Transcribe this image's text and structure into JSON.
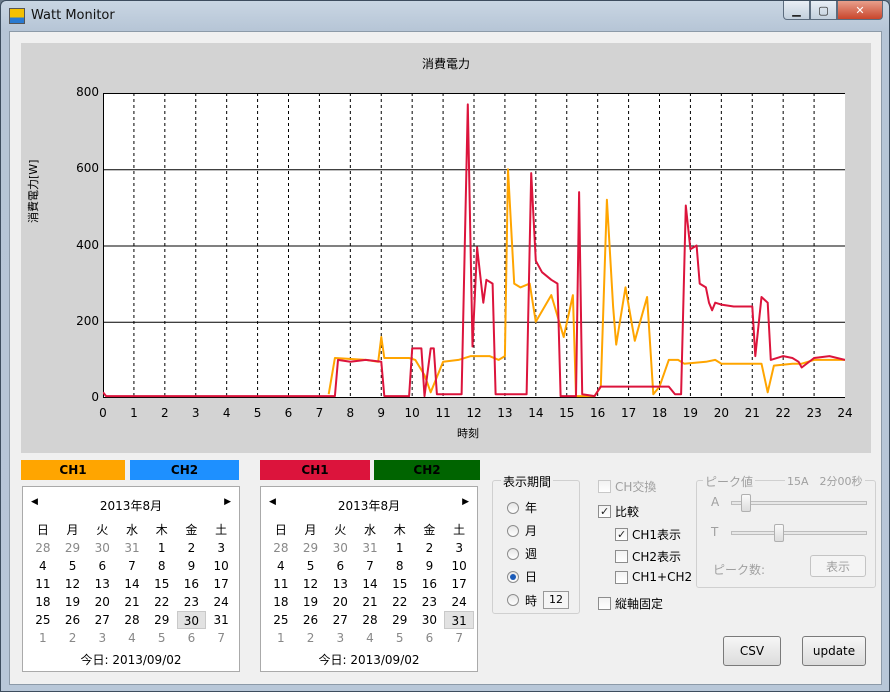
{
  "window": {
    "title": "Watt Monitor"
  },
  "chart_data": {
    "type": "line",
    "title": "消費電力",
    "xlabel": "時刻",
    "ylabel": "消費電力[W]",
    "xlim": [
      0,
      24
    ],
    "ylim": [
      0,
      800
    ],
    "x_ticks": [
      "0",
      "1",
      "2",
      "3",
      "4",
      "5",
      "6",
      "7",
      "8",
      "9",
      "10",
      "11",
      "12",
      "13",
      "14",
      "15",
      "16",
      "17",
      "18",
      "19",
      "20",
      "21",
      "22",
      "23",
      "24"
    ],
    "y_ticks": [
      "0",
      "200",
      "400",
      "600",
      "800"
    ],
    "series": [
      {
        "color": "#dc143c",
        "points": [
          [
            0,
            15
          ],
          [
            0.1,
            5
          ],
          [
            7.5,
            5
          ],
          [
            7.6,
            100
          ],
          [
            8,
            95
          ],
          [
            8.5,
            100
          ],
          [
            9,
            95
          ],
          [
            9.1,
            5
          ],
          [
            9.9,
            5
          ],
          [
            10,
            130
          ],
          [
            10.3,
            130
          ],
          [
            10.4,
            5
          ],
          [
            10.6,
            130
          ],
          [
            10.7,
            130
          ],
          [
            10.8,
            10
          ],
          [
            11.6,
            10
          ],
          [
            11.8,
            770
          ],
          [
            11.95,
            135
          ],
          [
            12.1,
            395
          ],
          [
            12.3,
            250
          ],
          [
            12.4,
            310
          ],
          [
            12.6,
            300
          ],
          [
            12.7,
            10
          ],
          [
            13.7,
            10
          ],
          [
            13.85,
            590
          ],
          [
            14,
            360
          ],
          [
            14.2,
            330
          ],
          [
            14.5,
            310
          ],
          [
            14.7,
            300
          ],
          [
            14.8,
            5
          ],
          [
            15.3,
            5
          ],
          [
            15.4,
            540
          ],
          [
            15.5,
            10
          ],
          [
            15.9,
            5
          ],
          [
            16.1,
            30
          ],
          [
            17.5,
            30
          ],
          [
            18.3,
            30
          ],
          [
            18.5,
            10
          ],
          [
            18.7,
            10
          ],
          [
            18.85,
            505
          ],
          [
            19,
            390
          ],
          [
            19.2,
            400
          ],
          [
            19.3,
            300
          ],
          [
            19.5,
            290
          ],
          [
            19.6,
            250
          ],
          [
            19.7,
            230
          ],
          [
            19.8,
            250
          ],
          [
            20,
            245
          ],
          [
            20.4,
            240
          ],
          [
            21,
            240
          ],
          [
            21.1,
            110
          ],
          [
            21.3,
            265
          ],
          [
            21.5,
            250
          ],
          [
            21.6,
            100
          ],
          [
            22,
            110
          ],
          [
            22.3,
            105
          ],
          [
            22.5,
            95
          ],
          [
            22.6,
            80
          ],
          [
            23,
            105
          ],
          [
            23.5,
            110
          ],
          [
            24,
            100
          ]
        ]
      },
      {
        "color": "#ffa500",
        "points": [
          [
            7.3,
            10
          ],
          [
            7.5,
            105
          ],
          [
            8.5,
            100
          ],
          [
            8.9,
            95
          ],
          [
            9,
            160
          ],
          [
            9.1,
            105
          ],
          [
            9.9,
            105
          ],
          [
            10.1,
            100
          ],
          [
            10.4,
            60
          ],
          [
            10.6,
            15
          ],
          [
            11,
            95
          ],
          [
            11.5,
            100
          ],
          [
            11.9,
            110
          ],
          [
            12.5,
            110
          ],
          [
            12.8,
            100
          ],
          [
            13,
            110
          ],
          [
            13.1,
            600
          ],
          [
            13.3,
            300
          ],
          [
            13.5,
            290
          ],
          [
            13.8,
            300
          ],
          [
            14,
            200
          ],
          [
            14.5,
            270
          ],
          [
            14.9,
            160
          ],
          [
            15.2,
            270
          ],
          [
            15.3,
            5
          ],
          [
            15.9,
            5
          ],
          [
            16.1,
            30
          ],
          [
            16.3,
            520
          ],
          [
            16.5,
            240
          ],
          [
            16.6,
            140
          ],
          [
            16.9,
            290
          ],
          [
            17.2,
            150
          ],
          [
            17.6,
            265
          ],
          [
            17.8,
            10
          ],
          [
            18,
            30
          ],
          [
            18.3,
            100
          ],
          [
            18.6,
            100
          ],
          [
            18.8,
            90
          ],
          [
            19.5,
            95
          ],
          [
            19.8,
            100
          ],
          [
            20,
            90
          ],
          [
            20.8,
            90
          ],
          [
            21.3,
            90
          ],
          [
            21.5,
            15
          ],
          [
            21.7,
            85
          ],
          [
            22.3,
            90
          ],
          [
            22.6,
            90
          ],
          [
            23,
            100
          ],
          [
            23.5,
            100
          ],
          [
            24,
            100
          ]
        ]
      }
    ]
  },
  "left_panel": {
    "tabs": [
      {
        "label": "CH1",
        "color": "#ffa500"
      },
      {
        "label": "CH2",
        "color": "#1e90ff"
      }
    ],
    "calendar": {
      "month": "2013年8月",
      "weekdays": [
        "日",
        "月",
        "火",
        "水",
        "木",
        "金",
        "土"
      ],
      "days": [
        "28",
        "29",
        "30",
        "31",
        "1",
        "2",
        "3",
        "4",
        "5",
        "6",
        "7",
        "8",
        "9",
        "10",
        "11",
        "12",
        "13",
        "14",
        "15",
        "16",
        "17",
        "18",
        "19",
        "20",
        "21",
        "22",
        "23",
        "24",
        "25",
        "26",
        "27",
        "28",
        "29",
        "30",
        "31",
        "1",
        "2",
        "3",
        "4",
        "5",
        "6",
        "7"
      ],
      "selected_index": 33,
      "today": "今日: 2013/09/02"
    }
  },
  "right_panel": {
    "tabs": [
      {
        "label": "CH1",
        "color": "#dc143c"
      },
      {
        "label": "CH2",
        "color": "#006400"
      }
    ],
    "calendar": {
      "month": "2013年8月",
      "weekdays": [
        "日",
        "月",
        "火",
        "水",
        "木",
        "金",
        "土"
      ],
      "days": [
        "28",
        "29",
        "30",
        "31",
        "1",
        "2",
        "3",
        "4",
        "5",
        "6",
        "7",
        "8",
        "9",
        "10",
        "11",
        "12",
        "13",
        "14",
        "15",
        "16",
        "17",
        "18",
        "19",
        "20",
        "21",
        "22",
        "23",
        "24",
        "25",
        "26",
        "27",
        "28",
        "29",
        "30",
        "31",
        "1",
        "2",
        "3",
        "4",
        "5",
        "6",
        "7"
      ],
      "selected_index": 34,
      "today": "今日: 2013/09/02"
    }
  },
  "period": {
    "title": "表示期間",
    "options": [
      {
        "label": "年",
        "checked": false
      },
      {
        "label": "月",
        "checked": false
      },
      {
        "label": "週",
        "checked": false
      },
      {
        "label": "日",
        "checked": true
      },
      {
        "label": "時",
        "checked": false
      }
    ],
    "hour_value": "12"
  },
  "options": {
    "ch_swap": "CH交換",
    "compare": "比較",
    "ch1_show": "CH1表示",
    "ch2_show": "CH2表示",
    "ch1_ch2": "CH1+CH2",
    "fix_axis": "縦軸固定"
  },
  "peak": {
    "title": "ピーク値",
    "status": "15A　2分00秒",
    "a_label": "A",
    "t_label": "T",
    "a_level": 0.08,
    "t_level": 0.34,
    "count_label": "ピーク数:",
    "show_button": "表示"
  },
  "buttons": {
    "csv": "CSV",
    "update": "update"
  }
}
